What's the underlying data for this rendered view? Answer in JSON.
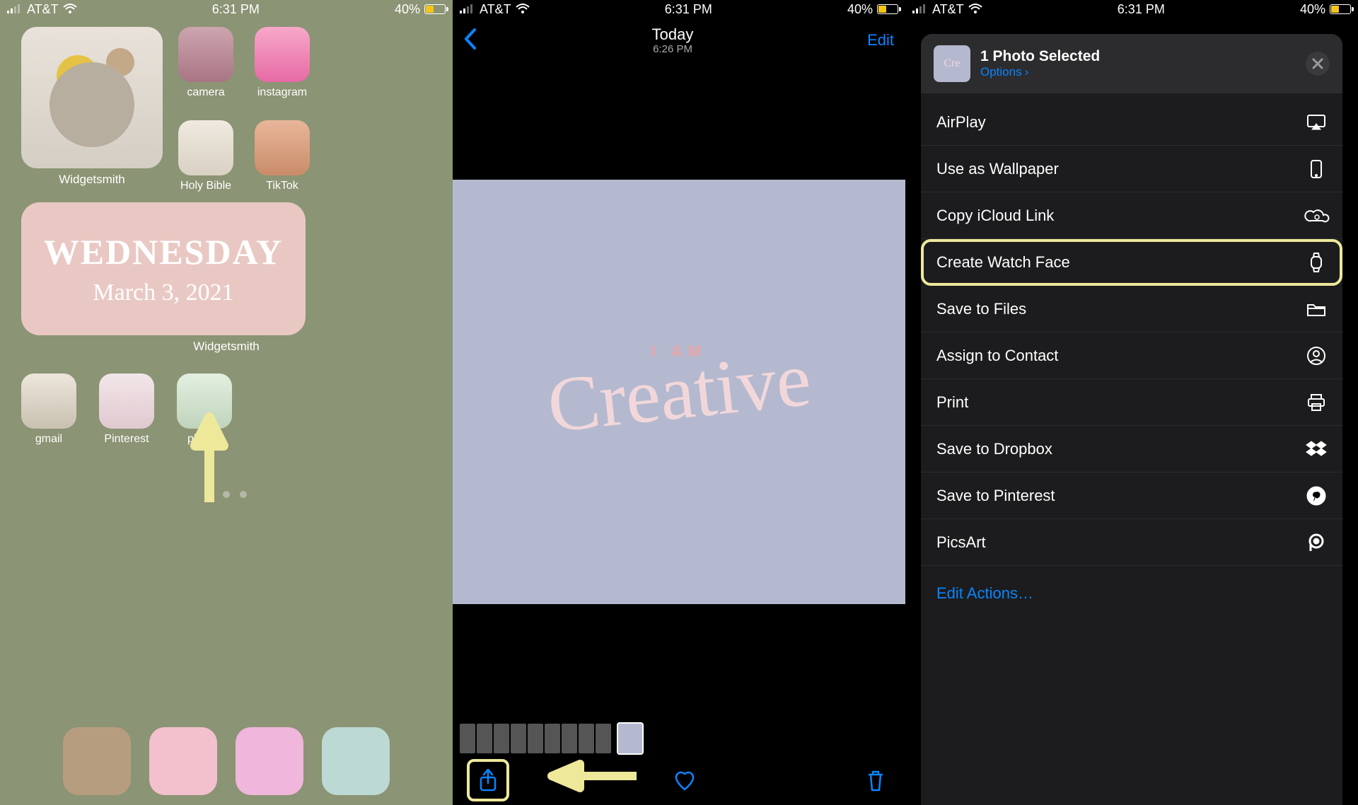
{
  "status": {
    "carrier": "AT&T",
    "time": "6:31 PM",
    "battery_pct": "40%"
  },
  "panel1": {
    "widget_big_label": "Widgetsmith",
    "apps_row1": [
      {
        "label": "camera"
      },
      {
        "label": "instagram"
      }
    ],
    "apps_row2": [
      {
        "label": "Holy Bible"
      },
      {
        "label": "TikTok"
      }
    ],
    "widget_med": {
      "day": "WEDNESDAY",
      "date": "March 3, 2021",
      "label": "Widgetsmith"
    },
    "apps_row3": [
      {
        "label": "gmail"
      },
      {
        "label": "Pinterest"
      },
      {
        "label": "photos"
      }
    ],
    "dock_colors": [
      "#b79d80",
      "#f3c0ce",
      "#f0b6db",
      "#bcd9d3"
    ]
  },
  "panel2": {
    "nav_title": "Today",
    "nav_sub": "6:26 PM",
    "edit_label": "Edit",
    "image_small": "I AM",
    "image_script": "Creative"
  },
  "panel3": {
    "header_title": "1 Photo Selected",
    "header_options": "Options",
    "actions": [
      {
        "label": "AirPlay",
        "icon": "airplay"
      },
      {
        "label": "Use as Wallpaper",
        "icon": "phone"
      },
      {
        "label": "Copy iCloud Link",
        "icon": "cloudlink"
      },
      {
        "label": "Create Watch Face",
        "icon": "watch",
        "highlight": true
      },
      {
        "label": "Save to Files",
        "icon": "folder"
      },
      {
        "label": "Assign to Contact",
        "icon": "person"
      },
      {
        "label": "Print",
        "icon": "printer"
      },
      {
        "label": "Save to Dropbox",
        "icon": "dropbox"
      },
      {
        "label": "Save to Pinterest",
        "icon": "pinterest"
      },
      {
        "label": "PicsArt",
        "icon": "picsart"
      }
    ],
    "edit_actions": "Edit Actions…"
  }
}
